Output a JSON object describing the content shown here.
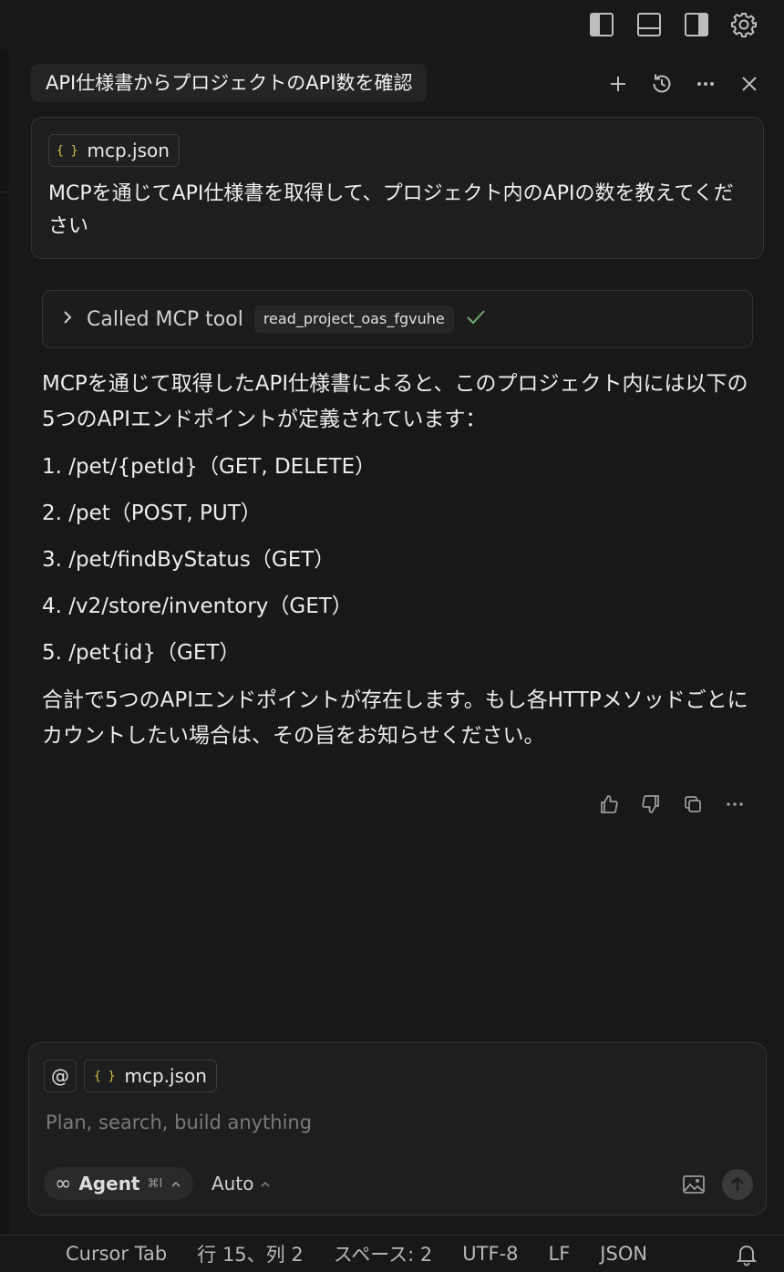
{
  "topbar": {
    "icons": [
      "layout-sidebar-left-icon",
      "layout-panel-icon",
      "layout-sidebar-right-icon",
      "gear-icon"
    ]
  },
  "chat": {
    "title": "API仕様書からプロジェクトのAPI数を確認",
    "header_icons": [
      "plus-icon",
      "history-icon",
      "more-icon",
      "close-icon"
    ]
  },
  "user_message": {
    "attachment": "mcp.json",
    "text": "MCPを通じてAPI仕様書を取得して、プロジェクト内のAPIの数を教えてください"
  },
  "tool_call": {
    "label": "Called MCP tool",
    "tool_name": "read_project_oas_fgvuhe",
    "status": "success"
  },
  "assistant": {
    "intro": "MCPを通じて取得したAPI仕様書によると、このプロジェクト内には以下の5つのAPIエンドポイントが定義されています：",
    "items": [
      "1. /pet/{petId}（GET, DELETE）",
      "2. /pet（POST, PUT）",
      "3. /pet/findByStatus（GET）",
      "4. /v2/store/inventory（GET）",
      "5. /pet{id}（GET）"
    ],
    "summary": "合計で5つのAPIエンドポイントが存在します。もし各HTTPメソッドごとにカウントしたい場合は、その旨をお知らせください。"
  },
  "feedback_icons": [
    "thumbs-up-icon",
    "thumbs-down-icon",
    "copy-icon",
    "more-icon"
  ],
  "composer": {
    "at_symbol": "@",
    "context_file": "mcp.json",
    "placeholder": "Plan, search, build anything",
    "mode": "Agent",
    "mode_shortcut": "⌘I",
    "model": "Auto"
  },
  "statusbar": {
    "cursor_tab": "Cursor Tab",
    "position": "行 15、列 2",
    "indent": "スペース: 2",
    "encoding": "UTF-8",
    "eol": "LF",
    "language": "JSON"
  }
}
